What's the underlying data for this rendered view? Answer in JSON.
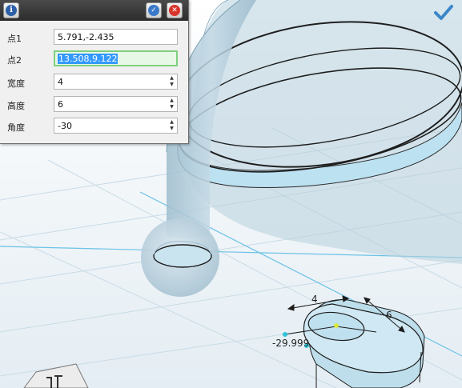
{
  "panel": {
    "fields": [
      {
        "label": "点1",
        "value": "5.791,-2.435"
      },
      {
        "label": "点2",
        "value": "13.508,9.122"
      },
      {
        "label": "宽度",
        "value": "4"
      },
      {
        "label": "高度",
        "value": "6"
      },
      {
        "label": "角度",
        "value": "-30"
      }
    ]
  },
  "viewport": {
    "dimensions": {
      "width_label": "4",
      "height_label": "6",
      "angle_label": "-29.999"
    }
  },
  "icons": {
    "info": "info-icon",
    "ok": "check-icon",
    "close": "close-icon",
    "confirm": "checkmark-icon"
  }
}
